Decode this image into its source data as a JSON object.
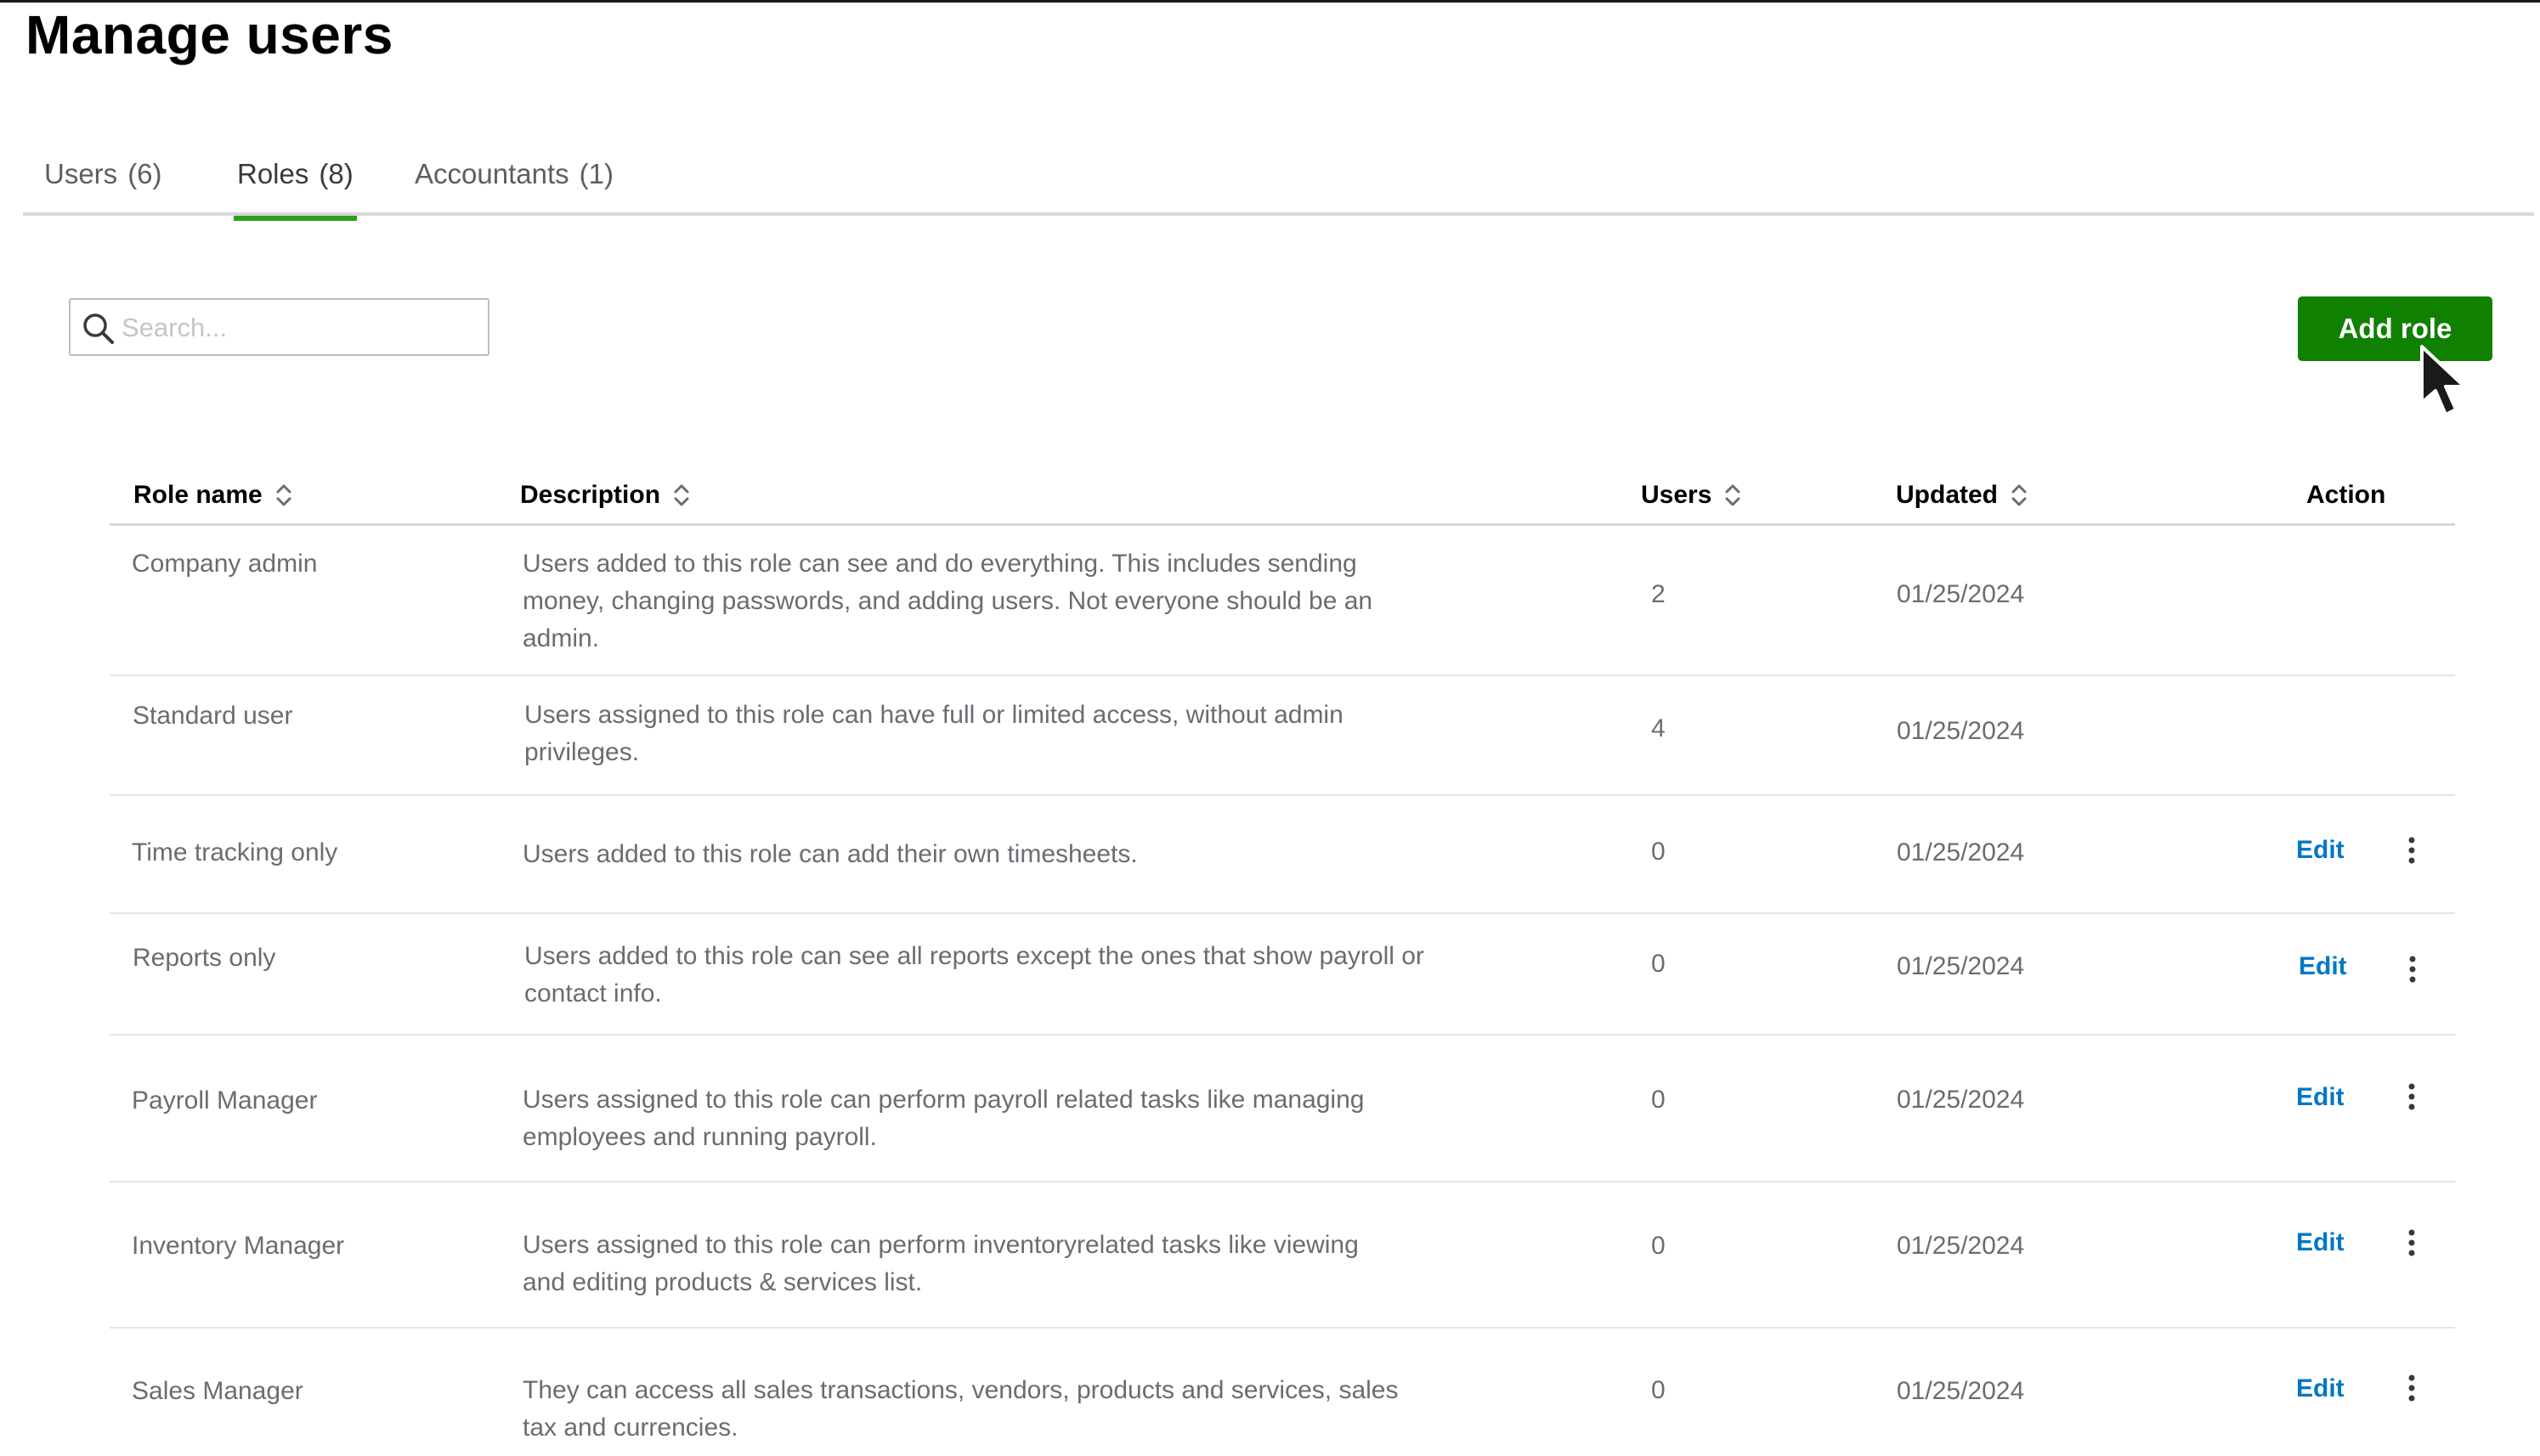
{
  "page": {
    "title": "Manage users"
  },
  "tabs": [
    {
      "label": "Users",
      "count": "(6)"
    },
    {
      "label": "Roles",
      "count": "(8)"
    },
    {
      "label": "Accountants",
      "count": "(1)"
    }
  ],
  "search": {
    "placeholder": "Search...",
    "value": ""
  },
  "toolbar": {
    "add_role_label": "Add role"
  },
  "table": {
    "headers": {
      "role_name": "Role name",
      "description": "Description",
      "users": "Users",
      "updated": "Updated",
      "action": "Action"
    },
    "rows": [
      {
        "role": "Company admin",
        "description": "Users added to this role can see and do everything. This includes sending money, changing passwords, and adding users. Not everyone should be an admin.",
        "users": "2",
        "updated": "01/25/2024",
        "edit": ""
      },
      {
        "role": "Standard user",
        "description": "Users assigned to this role can have full or limited access, without admin privileges.",
        "users": "4",
        "updated": "01/25/2024",
        "edit": ""
      },
      {
        "role": "Time tracking only",
        "description": "Users added to this role can add their own timesheets.",
        "users": "0",
        "updated": "01/25/2024",
        "edit": "Edit"
      },
      {
        "role": "Reports only",
        "description": "Users added to this role can see all reports except the ones that show payroll or contact info.",
        "users": "0",
        "updated": "01/25/2024",
        "edit": "Edit"
      },
      {
        "role": "Payroll Manager",
        "description": "Users assigned to this role can perform payroll related tasks like managing employees and running payroll.",
        "users": "0",
        "updated": "01/25/2024",
        "edit": "Edit"
      },
      {
        "role": "Inventory Manager",
        "description": "Users assigned to this role can perform inventoryrelated tasks like viewing and editing products & services list.",
        "users": "0",
        "updated": "01/25/2024",
        "edit": "Edit"
      },
      {
        "role": "Sales Manager",
        "description": "They can access all sales transactions, vendors, products and services, sales tax and currencies.",
        "users": "0",
        "updated": "01/25/2024",
        "edit": "Edit"
      }
    ]
  },
  "colors": {
    "accent": "#2ca01c",
    "primary_button": "#108000",
    "link": "#0077c5"
  }
}
